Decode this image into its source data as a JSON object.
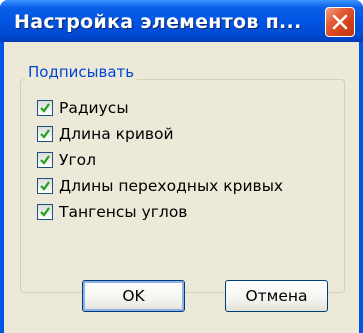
{
  "window": {
    "title": "Настройка элементов п...",
    "close_icon": "close-icon"
  },
  "group": {
    "title": "Подписывать",
    "items": [
      {
        "label": "Радиусы",
        "checked": true
      },
      {
        "label": "Длина кривой",
        "checked": true
      },
      {
        "label": "Угол",
        "checked": true
      },
      {
        "label": "Длины переходных кривых",
        "checked": true
      },
      {
        "label": "Тангенсы углов",
        "checked": true
      }
    ]
  },
  "buttons": {
    "ok": "OK",
    "cancel": "Отмена"
  },
  "colors": {
    "titlebar": "#0054e3",
    "client_bg": "#ece9d8",
    "group_title": "#0046d5",
    "close_button": "#d14018"
  }
}
